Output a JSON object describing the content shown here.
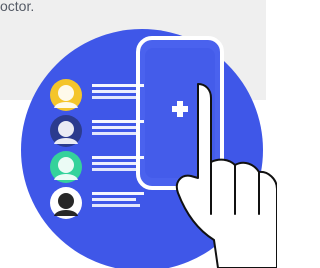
{
  "page": {
    "top_text": "octor."
  },
  "colors": {
    "gray_card": "#efefef",
    "blue_circle": "#3f57e8",
    "blue_light": "#5c73f2",
    "white": "#ffffff",
    "skin": "#ffffff",
    "avatar_gold": "#f4c52b",
    "avatar_teal": "#35d29b",
    "avatar_navy": "#2b3b8e",
    "outline": "#111111"
  },
  "icons": {
    "plus": "plus-icon",
    "hand": "hand-pointer-icon"
  }
}
